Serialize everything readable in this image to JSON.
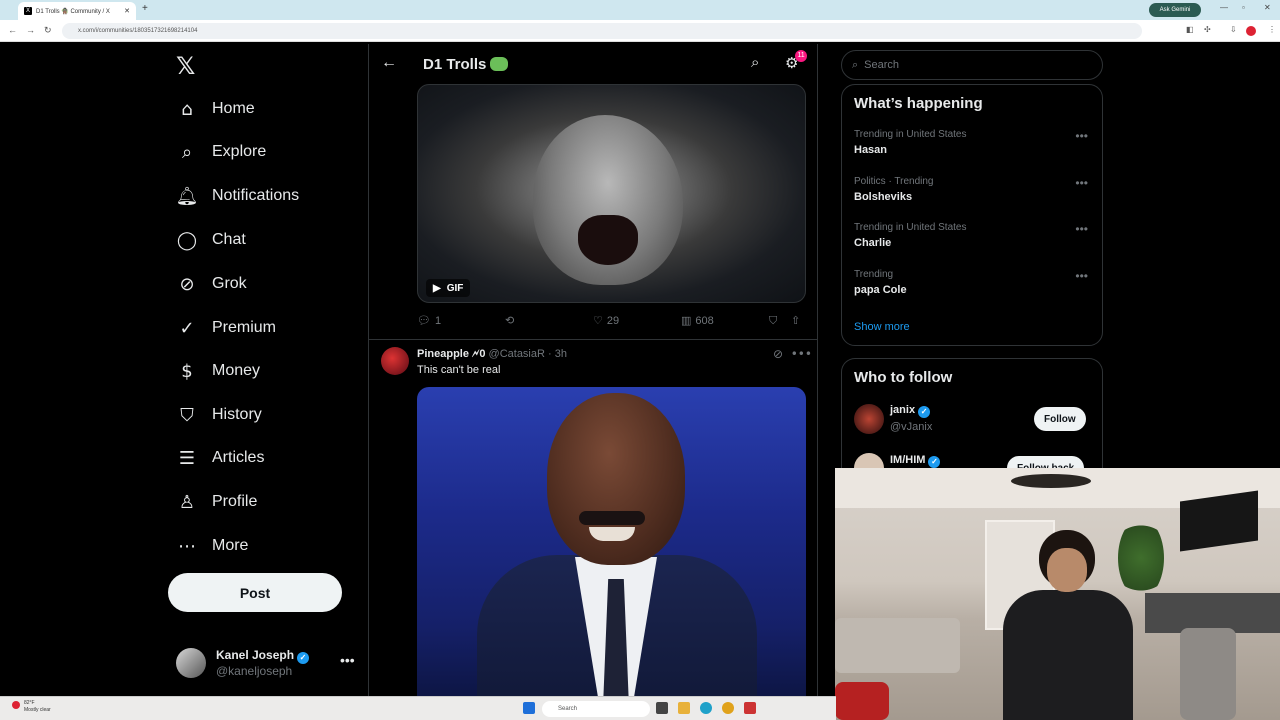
{
  "browser": {
    "tab_title": "D1 Trolls 🧌 Community / X",
    "new_tab": "+",
    "ask_gemini": "Ask Gemini",
    "url": "x.com/i/communities/1803517321698214104"
  },
  "sidebar": {
    "logo": "𝕏",
    "items": [
      {
        "label": "Home",
        "icon": "⌂"
      },
      {
        "label": "Explore",
        "icon": "⌕"
      },
      {
        "label": "Notifications",
        "icon": "🔔︎"
      },
      {
        "label": "Chat",
        "icon": "◯"
      },
      {
        "label": "Grok",
        "icon": "⊘"
      },
      {
        "label": "Premium",
        "icon": "✓"
      },
      {
        "label": "Money",
        "icon": "$"
      },
      {
        "label": "History",
        "icon": "⛉"
      },
      {
        "label": "Articles",
        "icon": "☰"
      },
      {
        "label": "Profile",
        "icon": "♙"
      },
      {
        "label": "More",
        "icon": "⋯"
      }
    ],
    "post_label": "Post",
    "account": {
      "name": "Kanel Joseph",
      "handle": "@kaneljoseph",
      "more": "•••"
    }
  },
  "community": {
    "back": "←",
    "title": "D1 Trolls",
    "notif_count": "11"
  },
  "tweet1": {
    "gif_label": "GIF",
    "replies": "1",
    "likes": "29",
    "views": "608"
  },
  "tweet2": {
    "name": "Pineapple 🗲0",
    "handle": "@CatasiaR",
    "time": "· 3h",
    "text": "This can't be real",
    "more": "•••"
  },
  "right": {
    "search_placeholder": "Search",
    "whats_happening": "What’s happening",
    "trends": [
      {
        "context": "Trending in United States",
        "title": "Hasan"
      },
      {
        "context": "Politics · Trending",
        "title": "Bolsheviks"
      },
      {
        "context": "Trending in United States",
        "title": "Charlie"
      },
      {
        "context": "Trending",
        "title": "papa Cole"
      }
    ],
    "trend_more": "•••",
    "show_more": "Show more",
    "who_to_follow": "Who to follow",
    "follows": [
      {
        "name": "janix",
        "handle": "@vJanix",
        "button": "Follow"
      },
      {
        "name": "IM/HIM",
        "handle": "",
        "button": "Follow back"
      }
    ]
  },
  "taskbar": {
    "weather_temp": "82°F",
    "weather_desc": "Mostly clear",
    "search": "Search"
  },
  "colors": {
    "accent": "#1d9bf0",
    "background": "#000000",
    "border": "#2f3336",
    "badge": "#f91880"
  }
}
